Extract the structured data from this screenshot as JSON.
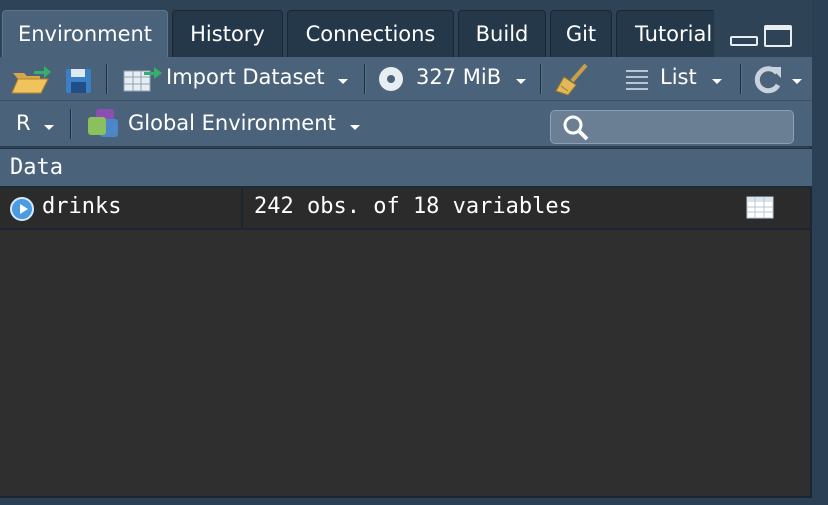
{
  "tabs": [
    {
      "label": "Environment",
      "active": true
    },
    {
      "label": "History",
      "active": false
    },
    {
      "label": "Connections",
      "active": false
    },
    {
      "label": "Build",
      "active": false
    },
    {
      "label": "Git",
      "active": false
    },
    {
      "label": "Tutorial",
      "active": false
    }
  ],
  "toolbar": {
    "import_label": "Import Dataset",
    "memory_label": "327 MiB",
    "view_label": "List"
  },
  "env": {
    "language": "R",
    "scope": "Global Environment",
    "search_placeholder": "",
    "search_value": ""
  },
  "section": {
    "title": "Data"
  },
  "rows": [
    {
      "name": "drinks",
      "value": "242 obs. of 18 variables"
    }
  ],
  "colors": {
    "toolbar_bg": "#4b637a",
    "tab_inactive": "#24384a",
    "data_bg": "#2f2f2f",
    "expand_icon": "#4b9be0"
  }
}
